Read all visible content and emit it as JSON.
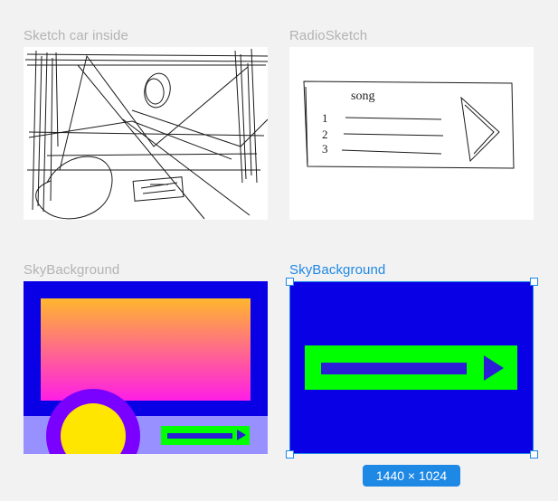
{
  "frames": [
    {
      "name": "Sketch car inside"
    },
    {
      "name": "RadioSketch"
    },
    {
      "name": "SkyBackground"
    },
    {
      "name": "SkyBackground",
      "selected": true
    }
  ],
  "radio_sketch_text": {
    "title": "song",
    "num1": "1",
    "num2": "2",
    "num3": "3"
  },
  "selection": {
    "size": "1440 × 1024"
  },
  "colors": {
    "selection": "#1e88e5",
    "sky_blue": "#0a00e6",
    "lavender": "#9990ff",
    "green": "#00ff00",
    "gradient_top": "#ffb72d",
    "gradient_bottom": "#ff1ee6",
    "sun_ring": "#7a00ff",
    "sun": "#ffe600"
  }
}
